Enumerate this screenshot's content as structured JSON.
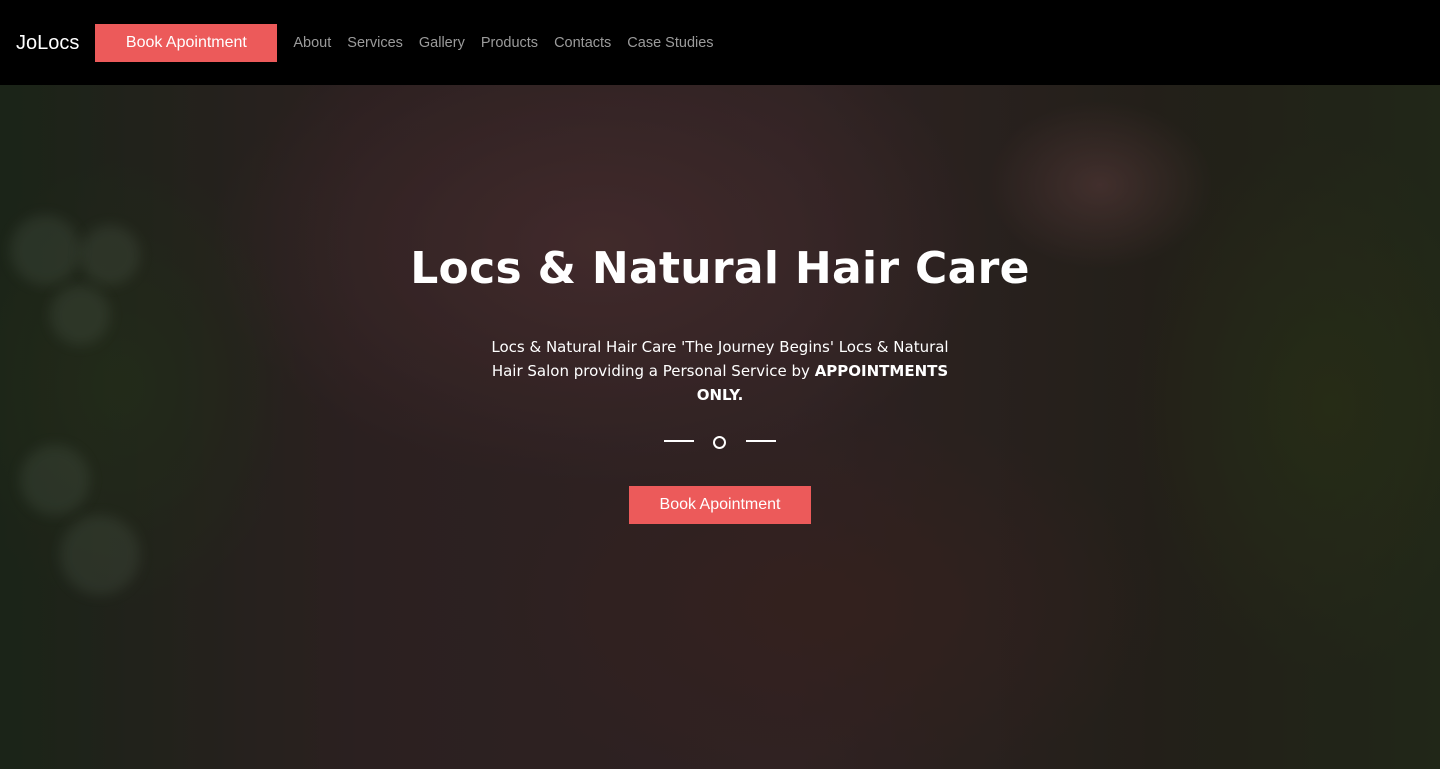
{
  "navbar": {
    "brand": "JoLocs",
    "book_button": "Book Apointment",
    "links": [
      "About",
      "Services",
      "Gallery",
      "Products",
      "Contacts",
      "Case Studies"
    ]
  },
  "hero": {
    "title": "Locs & Natural Hair Care",
    "description": "Locs & Natural Hair Care 'The Journey Begins' Locs & Natural Hair Salon providing a Personal Service by",
    "description_emphasis": "APPOINTMENTS ONLY.",
    "book_button": "Book Apointment"
  },
  "colors": {
    "accent": "#ec5a5a",
    "navbar_bg": "#000000",
    "nav_link": "#9b9b9b"
  }
}
